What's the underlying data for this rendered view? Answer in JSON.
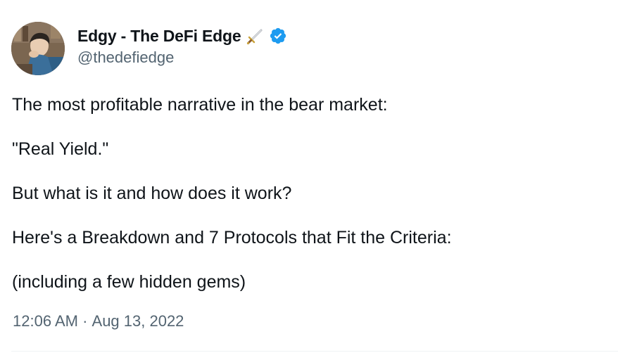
{
  "author": {
    "display_name": "Edgy - The DeFi Edge",
    "handle": "@thedefiedge",
    "verified": true,
    "emoji_icon": "dagger-icon",
    "accent_color": "#1d9bf0"
  },
  "tweet": {
    "paragraphs": [
      "The most profitable narrative in the bear market:",
      "\"Real Yield.\"",
      "But what is it and how does it work?",
      "Here's a Breakdown and 7 Protocols that Fit the Criteria:",
      "(including a few hidden gems)"
    ],
    "time": "12:06 AM",
    "separator": " · ",
    "date": "Aug 13, 2022"
  },
  "colors": {
    "text_primary": "#0f1419",
    "text_secondary": "#536471",
    "divider": "#eff3f4"
  }
}
